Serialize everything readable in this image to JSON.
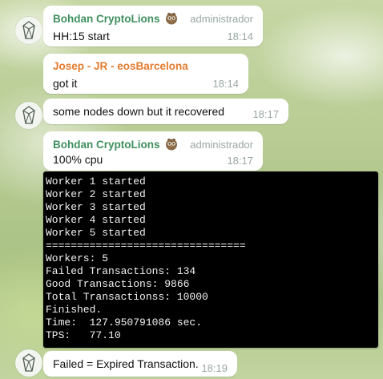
{
  "chat": {
    "messages": [
      {
        "sender": "Bohdan CryptoLions",
        "role": "administrador",
        "text": "HH:15 start",
        "time": "18:14",
        "sender_color": "#3f8f5e",
        "sender_icon": "owl-emoji-icon"
      },
      {
        "sender": "Josep - JR - eosBarcelona",
        "text": "got it",
        "time": "18:14",
        "sender_color": "#e57b2f"
      },
      {
        "text": "some nodes down but it recovered",
        "time": "18:17"
      },
      {
        "sender": "Bohdan CryptoLions",
        "role": "administrador",
        "text": "100% cpu",
        "time": "18:17",
        "sender_color": "#3f8f5e",
        "sender_icon": "owl-emoji-icon"
      },
      {
        "text": "Failed = Expired Transaction.",
        "time": "18:19"
      }
    ],
    "terminal": {
      "lines": [
        "Worker 1 started",
        "Worker 2 started",
        "Worker 3 started",
        "Worker 4 started",
        "Worker 5 started",
        "================================",
        "Workers: 5",
        "Failed Transactions: 134",
        "Good Transactions: 9866",
        "Total Transactionss: 10000",
        "Finished.",
        "Time:  127.950791086 sec.",
        "TPS:   77.10"
      ]
    }
  },
  "colors": {
    "admin_green": "#3f8f5e",
    "sender_orange": "#e57b2f",
    "meta_grey": "#9aa7a0",
    "bubble_white": "#ffffff",
    "terminal_black": "#000000"
  },
  "icons": {
    "avatar": "eos-logo-icon",
    "owl": "owl-emoji-icon"
  }
}
